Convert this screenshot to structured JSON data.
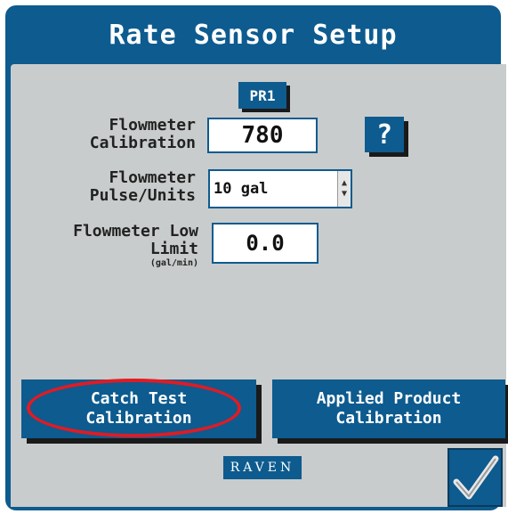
{
  "header": {
    "title": "Rate Sensor Setup"
  },
  "product_tab": {
    "label": "PR1"
  },
  "fields": {
    "calibration": {
      "label_line1": "Flowmeter",
      "label_line2": "Calibration",
      "value": "780"
    },
    "pulse_units": {
      "label_line1": "Flowmeter",
      "label_line2": "Pulse/Units",
      "value": "10 gal"
    },
    "low_limit": {
      "label_line1": "Flowmeter Low",
      "label_line2": "Limit",
      "unit": "(gal/min)",
      "value": "0.0"
    }
  },
  "help": {
    "label": "?"
  },
  "buttons": {
    "catch_test": {
      "line1": "Catch Test",
      "line2": "Calibration"
    },
    "applied_product": {
      "line1": "Applied Product",
      "line2": "Calibration"
    }
  },
  "brand": {
    "logo_text": "RAVEN"
  },
  "colors": {
    "accent": "#0d5b8f",
    "panel": "#c9cccc",
    "highlight": "#e01b24"
  },
  "icons": {
    "confirm": "checkmark-icon",
    "spinner": "up-down-arrows-icon"
  }
}
